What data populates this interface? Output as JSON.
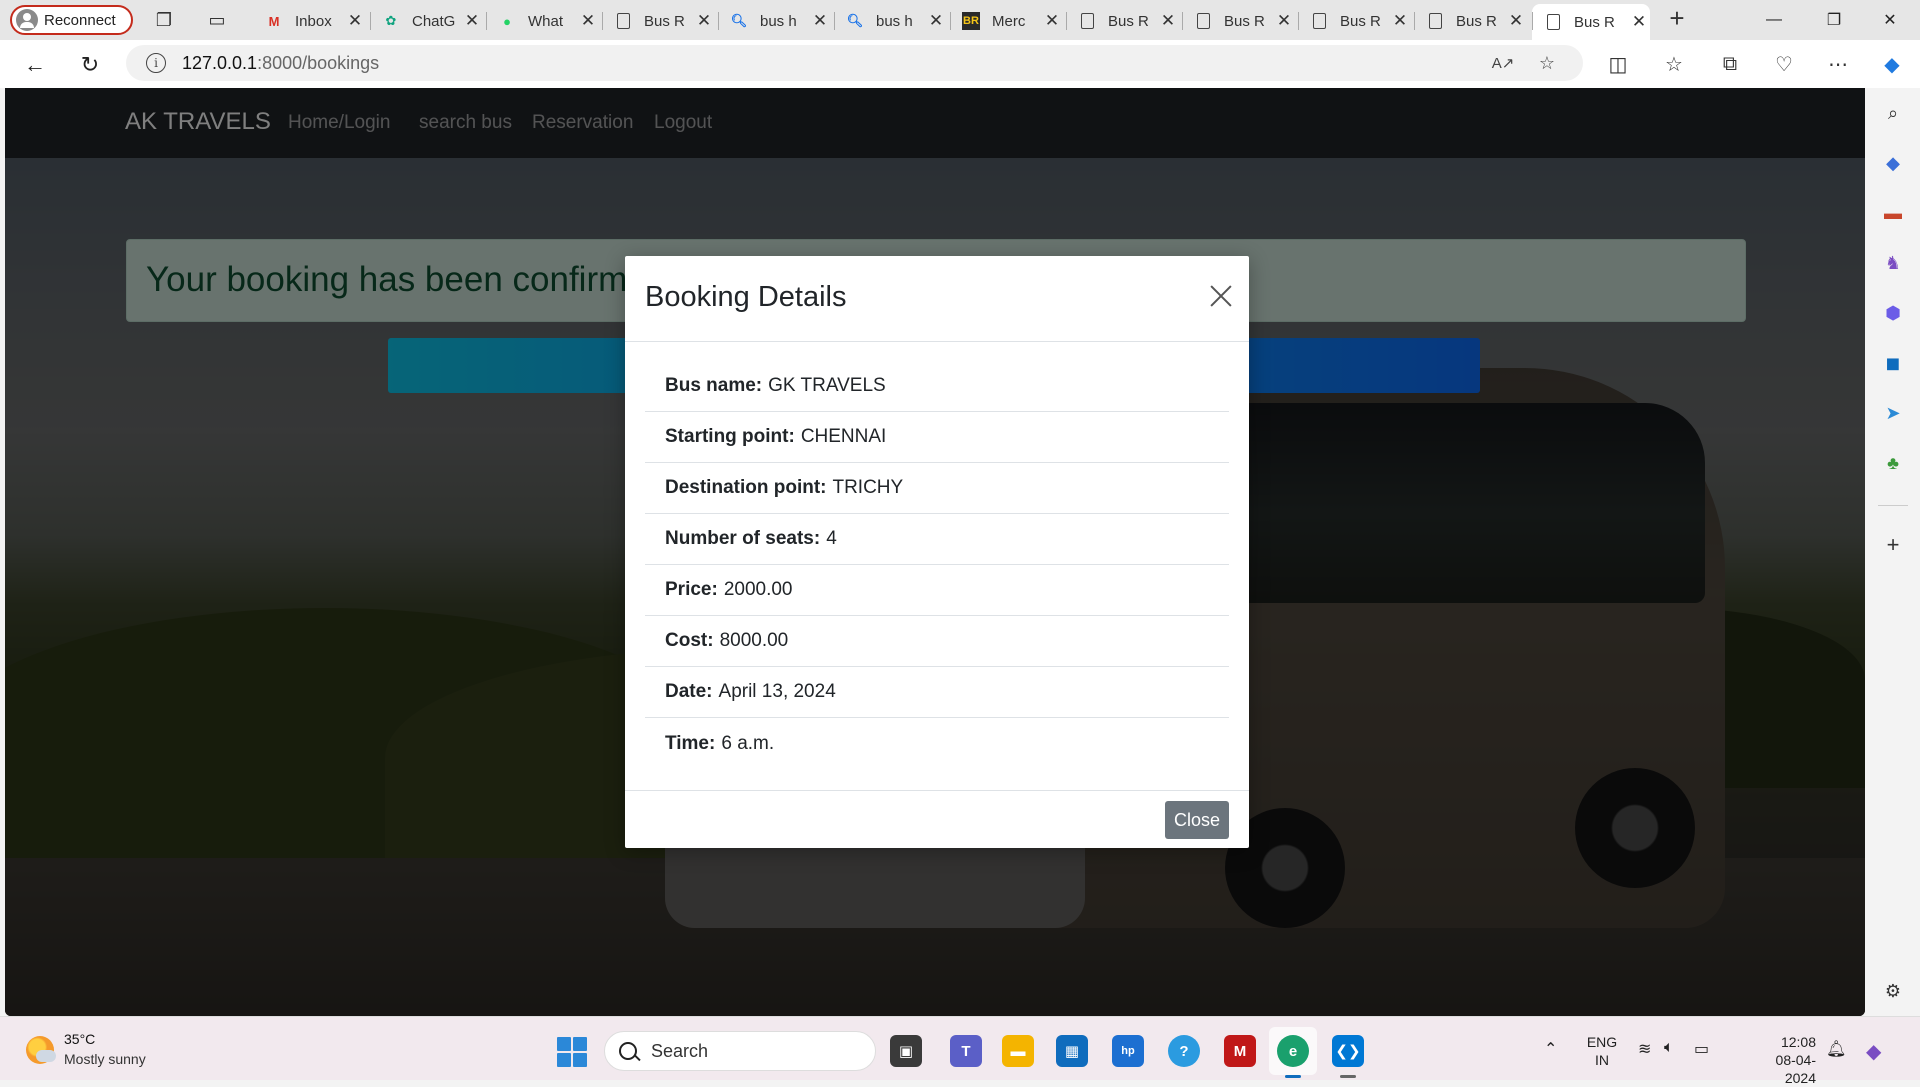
{
  "browser": {
    "profile_label": "Reconnect",
    "tabs": [
      {
        "label": "Inbox",
        "icon": "gmail-icon"
      },
      {
        "label": "ChatG",
        "icon": "chatgpt-icon"
      },
      {
        "label": "What",
        "icon": "whatsapp-icon"
      },
      {
        "label": "Bus R",
        "icon": "page-icon"
      },
      {
        "label": "bus h",
        "icon": "search-icon"
      },
      {
        "label": "bus h",
        "icon": "search-icon"
      },
      {
        "label": "Merc",
        "icon": "br-icon"
      },
      {
        "label": "Bus R",
        "icon": "page-icon"
      },
      {
        "label": "Bus R",
        "icon": "page-icon"
      },
      {
        "label": "Bus R",
        "icon": "page-icon"
      },
      {
        "label": "Bus R",
        "icon": "page-icon"
      },
      {
        "label": "Bus R",
        "icon": "page-icon",
        "active": true
      }
    ],
    "url_host": "127.0.0.1",
    "url_rest": ":8000/bookings"
  },
  "app": {
    "brand": "AK TRAVELS",
    "nav": [
      "Home/Login",
      "search bus",
      "Reservation",
      "Logout"
    ],
    "alert_text": "Your booking has been confirmed!"
  },
  "modal": {
    "title": "Booking Details",
    "rows": [
      {
        "label": "Bus name:",
        "value": "GK TRAVELS"
      },
      {
        "label": "Starting point:",
        "value": "CHENNAI"
      },
      {
        "label": "Destination point:",
        "value": "TRICHY"
      },
      {
        "label": "Number of seats:",
        "value": "4"
      },
      {
        "label": "Price:",
        "value": "2000.00"
      },
      {
        "label": "Cost:",
        "value": "8000.00"
      },
      {
        "label": "Date:",
        "value": "April 13, 2024"
      },
      {
        "label": "Time:",
        "value": "6 a.m."
      }
    ],
    "close_label": "Close"
  },
  "taskbar": {
    "weather_temp": "35°C",
    "weather_desc": "Mostly sunny",
    "search_label": "Search",
    "lang_top": "ENG",
    "lang_bottom": "IN",
    "time": "12:08",
    "date": "08-04-2024"
  },
  "colors": {
    "navbar": "#212529",
    "alert_bg": "#d1e7dd",
    "alert_text": "#0f5132",
    "close_button": "#6c757d",
    "profile_border": "#c42b1c"
  }
}
